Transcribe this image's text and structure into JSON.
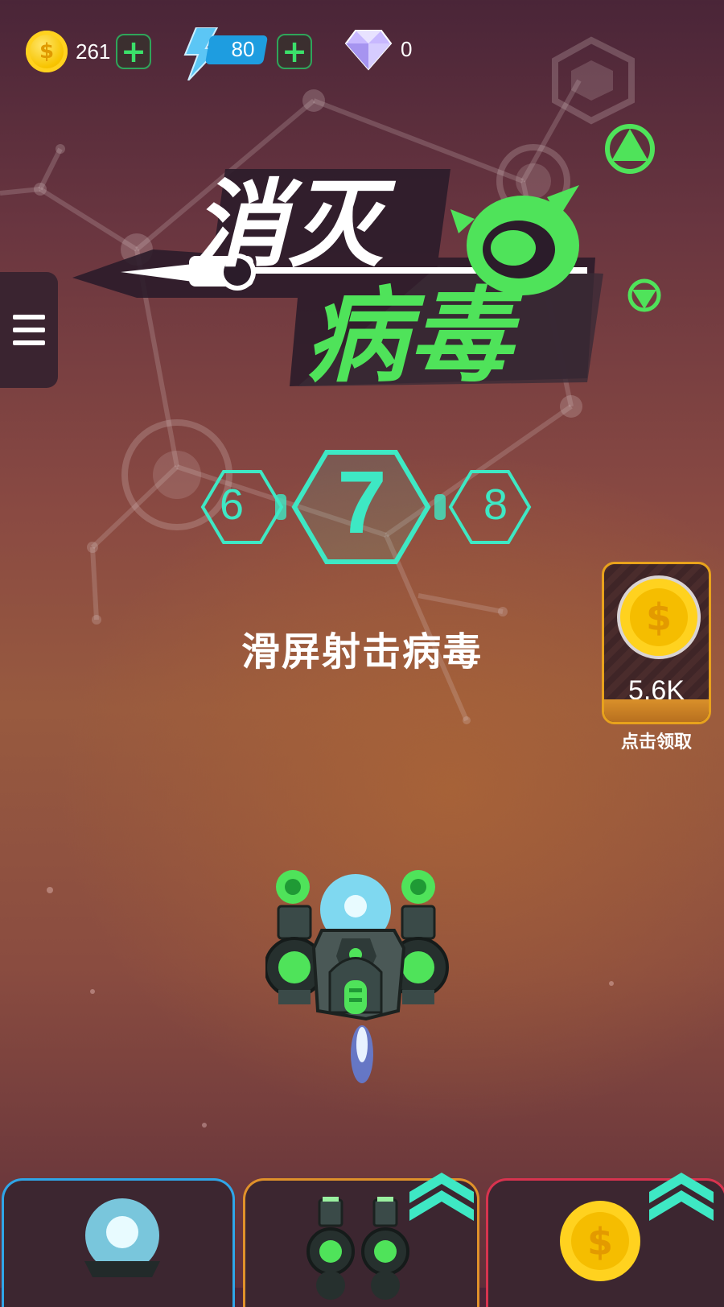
{
  "resources": {
    "coins": "261",
    "coin_symbol": "$",
    "energy": "80",
    "gems": "0"
  },
  "title": {
    "line1": "消灭",
    "line2": "病毒"
  },
  "levels": {
    "previous": "6",
    "current": "7",
    "next": "8"
  },
  "instruction": "滑屏射击病毒",
  "reward": {
    "amount": "5.6K",
    "symbol": "$",
    "caption": "点击领取"
  },
  "upgrades": [
    {
      "name": "weapon",
      "border_color": "#2fa6e8"
    },
    {
      "name": "wing-cannons",
      "border_color": "#e0912a",
      "upgrade_available": true
    },
    {
      "name": "coin-income",
      "border_color": "#d8334f",
      "upgrade_available": true,
      "symbol": "$"
    }
  ],
  "colors": {
    "accent_green": "#4fe35a",
    "level_teal": "#3ee8c4",
    "coin_gold": "#f7c400",
    "energy_blue": "#1e9de0"
  }
}
